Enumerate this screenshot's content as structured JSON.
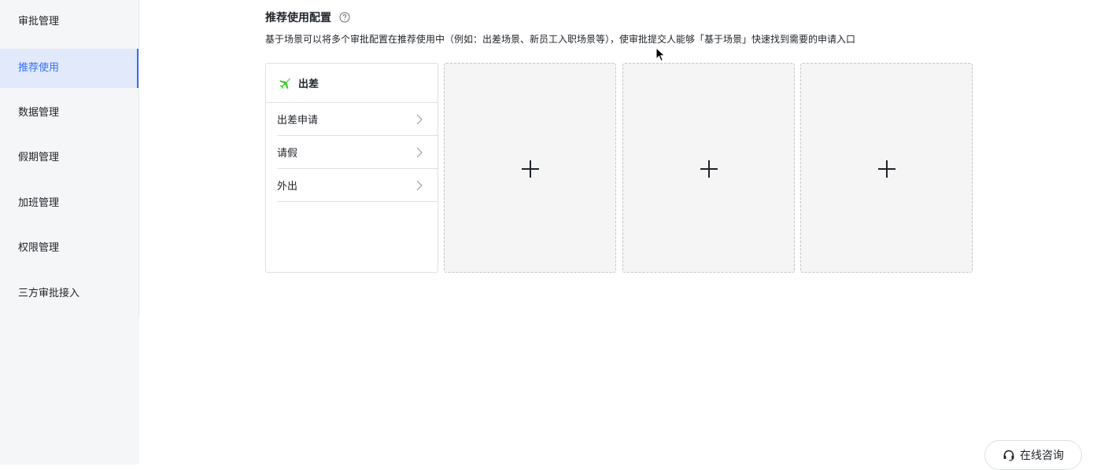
{
  "sidebar": {
    "items": [
      {
        "label": "审批管理",
        "active": false
      },
      {
        "label": "推荐使用",
        "active": true
      },
      {
        "label": "数据管理",
        "active": false
      },
      {
        "label": "假期管理",
        "active": false
      },
      {
        "label": "加班管理",
        "active": false
      },
      {
        "label": "权限管理",
        "active": false
      },
      {
        "label": "三方审批接入",
        "active": false
      }
    ]
  },
  "main": {
    "title": "推荐使用配置",
    "description": "基于场景可以将多个审批配置在推荐使用中（例如：出差场景、新员工入职场景等），使审批提交人能够「基于场景」快速找到需要的申请入口",
    "scene_card": {
      "icon": "airplane-icon",
      "name": "出差",
      "items": [
        "出差申请",
        "请假",
        "外出"
      ]
    },
    "add_slots": 3
  },
  "consult_button": {
    "label": "在线咨询",
    "icon": "headset-icon"
  },
  "colors": {
    "accent": "#3370ff",
    "active_bg": "#e1e9fb",
    "scene_icon": "#34c724"
  }
}
